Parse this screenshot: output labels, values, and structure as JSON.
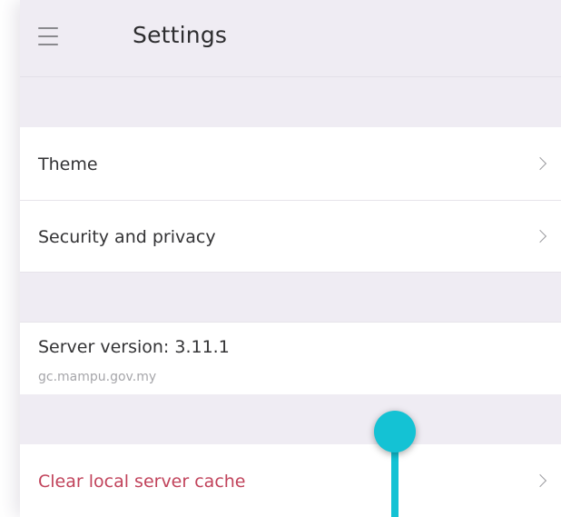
{
  "header": {
    "title": "Settings",
    "menu_icon": "hamburger-menu-icon"
  },
  "settings": {
    "theme_label": "Theme",
    "security_label": "Security and privacy",
    "server_version_label": "Server version: 3.11.1",
    "server_host": "gc.mampu.gov.my",
    "clear_cache_label": "Clear local server cache"
  },
  "colors": {
    "accent_danger": "#c1435b",
    "touch_indicator": "#14c2d4",
    "header_background": "#efecf3"
  }
}
